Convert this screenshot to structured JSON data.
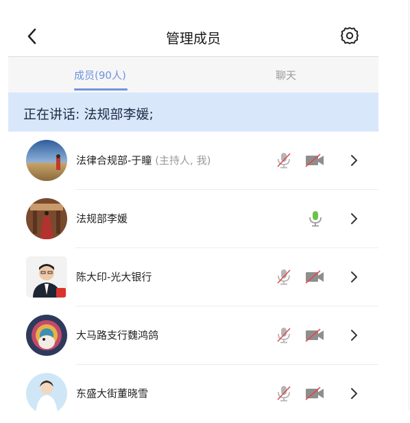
{
  "header": {
    "title": "管理成员"
  },
  "tabs": {
    "members": "成员(90人)",
    "chat": "聊天"
  },
  "speaking": {
    "text": "正在讲话: 法规部李媛;"
  },
  "members": [
    {
      "name": "法律合规部-于瞳",
      "tag": " (主持人, 我)",
      "mic": "muted",
      "camera": "off"
    },
    {
      "name": "法规部李媛",
      "tag": "",
      "mic": "active",
      "camera": "none"
    },
    {
      "name": "陈大印-光大银行",
      "tag": "",
      "mic": "muted",
      "camera": "off"
    },
    {
      "name": "大马路支行魏鸿鸽",
      "tag": "",
      "mic": "muted",
      "camera": "off"
    },
    {
      "name": "东盛大街董晓雪",
      "tag": "",
      "mic": "muted",
      "camera": "off"
    }
  ],
  "colors": {
    "accent": "#6f93e0",
    "speaking_bg": "#d9e7fb",
    "mic_active": "#6cc24a",
    "muted_red": "#e04848"
  },
  "icons": {
    "back": "chevron-left-icon",
    "settings": "gear-icon",
    "mic_muted": "mic-muted-icon",
    "mic_active": "mic-active-icon",
    "camera_off": "camera-off-icon",
    "row_arrow": "chevron-right-icon"
  }
}
